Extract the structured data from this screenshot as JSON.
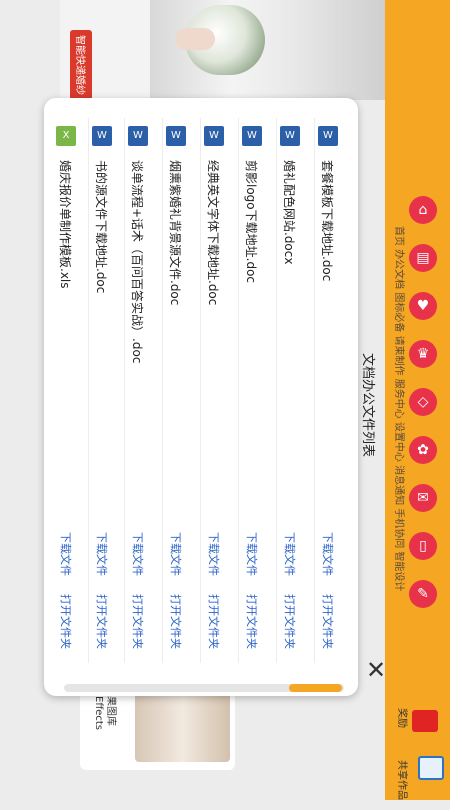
{
  "background": {
    "banner_text": "智能快递婚纱",
    "card_line1": "果图库",
    "card_line2": "Effects"
  },
  "sidebar": {
    "nav_labels_text": "首页 办公文档 图标必备 请柬制作 服务中心 设置中心 消息通知 手机协同 智能设计",
    "items": [
      {
        "label": "首页",
        "icon": "home-icon"
      },
      {
        "label": "办公文档",
        "icon": "document-icon"
      },
      {
        "label": "图标必备",
        "icon": "heart-icon"
      },
      {
        "label": "请柬制作",
        "icon": "crown-icon"
      },
      {
        "label": "服务中心",
        "icon": "diamond-icon"
      },
      {
        "label": "设置中心",
        "icon": "gear-icon"
      },
      {
        "label": "消息通知",
        "icon": "mail-icon"
      },
      {
        "label": "手机协同",
        "icon": "phone-icon"
      },
      {
        "label": "智能设计",
        "icon": "pen-icon"
      }
    ],
    "reward_label": "奖励",
    "share_label": "共享作品"
  },
  "modal": {
    "title": "文档办公文件列表",
    "download_label": "下载文件",
    "open_folder_label": "打开文件夹",
    "files": [
      {
        "name": "套餐模板下载地址.doc",
        "type": "word"
      },
      {
        "name": "婚礼配色网站.docx",
        "type": "word"
      },
      {
        "name": "剪影logo下载地址.doc",
        "type": "word"
      },
      {
        "name": "经典英文字体下载地址.doc",
        "type": "word"
      },
      {
        "name": "烟熏紫婚礼背景源文件.doc",
        "type": "word"
      },
      {
        "name": "谈单流程+话术（百问百答实战）.doc",
        "type": "word"
      },
      {
        "name": "书的源文件下载地址.doc",
        "type": "word"
      },
      {
        "name": "婚庆报价单制作模板.xls",
        "type": "excel"
      }
    ]
  },
  "colors": {
    "sidebar": "#f5a623",
    "accent_red": "#e8324a",
    "link": "#2a62c8",
    "word_icon": "#2b5fa8",
    "excel_icon": "#7ab648"
  }
}
